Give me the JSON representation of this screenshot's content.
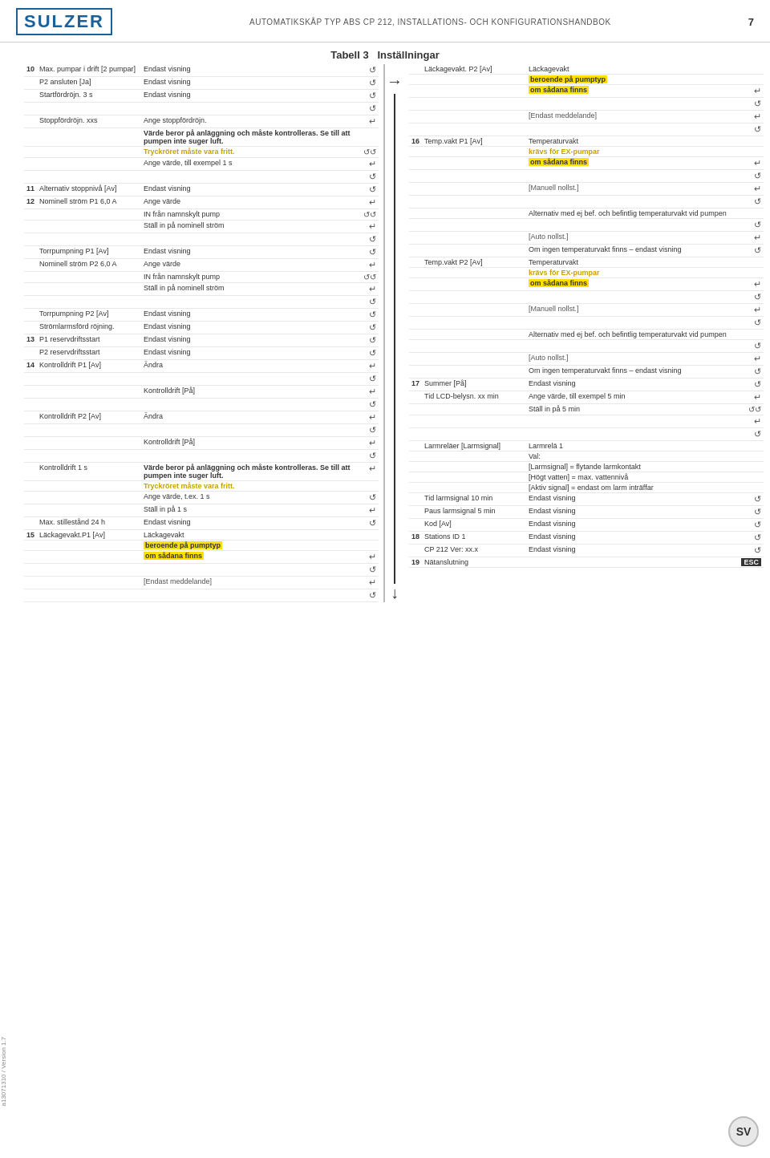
{
  "header": {
    "logo": "SULZER",
    "title": "AUTOMATIKSKÅP TYP ABS CP 212, INSTALLATIONS- OCH KONFIGURATIONSHANDBOK",
    "page_number": "7"
  },
  "table_title": "Tabell 3",
  "table_subtitle": "Inställningar",
  "sidebar_text": "a13071310 / Version 1.7",
  "sv_label": "SV",
  "left_column": {
    "rows": [
      {
        "num": "10",
        "label": "Max. pumpar i drift [2 pumpar]",
        "desc": "Endast visning",
        "icon": "↺",
        "highlight": false
      },
      {
        "num": "",
        "label": "P2 ansluten   [Ja]",
        "desc": "Endast visning",
        "icon": "↺",
        "highlight": false
      },
      {
        "num": "",
        "label": "Startfördröjn.   3 s",
        "desc": "Endast visning",
        "icon": "↺",
        "highlight": false
      },
      {
        "num": "",
        "label": "",
        "desc": "",
        "icon": "↺",
        "highlight": false
      },
      {
        "num": "",
        "label": "Stoppfördröjn.   xxs",
        "desc": "Ange stoppfördröjn.",
        "icon": "↵",
        "highlight": false
      },
      {
        "num": "",
        "label": "",
        "desc": "Värde beror på anläggning och måste kontrolleras. Se till att pumpen inte suger luft.",
        "icon": "",
        "highlight": false,
        "desc_bold": true
      },
      {
        "num": "",
        "label": "",
        "desc": "Tryckröret måste vara fritt.",
        "icon": "↺↺",
        "highlight": true,
        "yellow": true
      },
      {
        "num": "",
        "label": "",
        "desc": "Ange värde, till exempel 1 s",
        "icon": "↵",
        "highlight": false
      },
      {
        "num": "",
        "label": "",
        "desc": "",
        "icon": "↺",
        "highlight": false
      },
      {
        "num": "11",
        "label": "Alternativ stoppnivå   [Av]",
        "desc": "Endast visning",
        "icon": "↺",
        "highlight": false
      },
      {
        "num": "12",
        "label": "Nominell ström P1 6,0 A",
        "desc": "Ange värde",
        "icon": "↵",
        "highlight": false
      },
      {
        "num": "",
        "label": "",
        "desc": "IN från namnskylt pump",
        "icon": "↺↺",
        "highlight": false
      },
      {
        "num": "",
        "label": "",
        "desc": "Ställ in på nominell ström",
        "icon": "↵",
        "highlight": false
      },
      {
        "num": "",
        "label": "",
        "desc": "",
        "icon": "↺",
        "highlight": false
      },
      {
        "num": "",
        "label": "Torrpumpning P1   [Av]",
        "desc": "Endast visning",
        "icon": "↺",
        "highlight": false
      },
      {
        "num": "",
        "label": "Nominell ström P2 6,0 A",
        "desc": "Ange värde",
        "icon": "↵",
        "highlight": false
      },
      {
        "num": "",
        "label": "",
        "desc": "IN från namnskylt pump",
        "icon": "↺↺",
        "highlight": false
      },
      {
        "num": "",
        "label": "",
        "desc": "Ställ in på nominell ström",
        "icon": "↵",
        "highlight": false
      },
      {
        "num": "",
        "label": "",
        "desc": "",
        "icon": "↺",
        "highlight": false
      },
      {
        "num": "",
        "label": "Torrpumpning P2   [Av]",
        "desc": "Endast visning",
        "icon": "↺",
        "highlight": false
      },
      {
        "num": "",
        "label": "Strömlarmsförd röjning.",
        "desc": "Endast visning",
        "icon": "↺",
        "highlight": false
      },
      {
        "num": "13",
        "label": "P1 reservdriftsstart",
        "desc": "Endast visning",
        "icon": "↺",
        "highlight": false
      },
      {
        "num": "",
        "label": "P2 reservdriftsstart",
        "desc": "Endast visning",
        "icon": "↺",
        "highlight": false
      },
      {
        "num": "14",
        "label": "Kontrolldrift P1   [Av]",
        "desc": "Ändra",
        "icon": "↵",
        "highlight": false
      },
      {
        "num": "",
        "label": "",
        "desc": "",
        "icon": "↺",
        "highlight": false
      },
      {
        "num": "",
        "label": "",
        "desc": "Kontrolldrift [På]",
        "icon": "↵",
        "highlight": false
      },
      {
        "num": "",
        "label": "",
        "desc": "",
        "icon": "↺",
        "highlight": false
      },
      {
        "num": "",
        "label": "Kontrolldrift P2   [Av]",
        "desc": "Ändra",
        "icon": "↵",
        "highlight": false
      },
      {
        "num": "",
        "label": "",
        "desc": "",
        "icon": "↺",
        "highlight": false
      },
      {
        "num": "",
        "label": "",
        "desc": "Kontrolldrift [På]",
        "icon": "↵",
        "highlight": false
      },
      {
        "num": "",
        "label": "",
        "desc": "",
        "icon": "↺",
        "highlight": false
      },
      {
        "num": "",
        "label": "Kontrolldrift   1 s",
        "desc": "Värde beror på anläggning och måste kontrolleras. Se till att pumpen inte suger luft.",
        "icon": "↵",
        "highlight": false,
        "desc_bold": true
      },
      {
        "num": "",
        "label": "",
        "desc": "Tryckröret måste vara fritt.",
        "icon": "",
        "highlight": true,
        "yellow": true
      },
      {
        "num": "",
        "label": "",
        "desc": "Ange värde, t.ex. 1 s",
        "icon": "↺",
        "highlight": false
      },
      {
        "num": "",
        "label": "",
        "desc": "Ställ in på 1 s",
        "icon": "↵",
        "highlight": false
      },
      {
        "num": "",
        "label": "Max. stillestånd   24 h",
        "desc": "Endast visning",
        "icon": "↺",
        "highlight": false
      },
      {
        "num": "15",
        "label": "Läckagevakt.P1 [Av]",
        "desc": "Läckagevakt",
        "icon": "",
        "highlight": false
      },
      {
        "num": "",
        "label": "",
        "desc": "beroende på pumptyp",
        "icon": "",
        "highlight": true
      },
      {
        "num": "",
        "label": "",
        "desc": "om sådana finns",
        "icon": "↵",
        "highlight": true
      },
      {
        "num": "",
        "label": "",
        "desc": "",
        "icon": "↺",
        "highlight": false
      },
      {
        "num": "",
        "label": "",
        "desc": "[Endast meddelande]",
        "icon": "↵",
        "highlight": false,
        "bracket": true
      },
      {
        "num": "",
        "label": "",
        "desc": "",
        "icon": "↺",
        "highlight": false
      }
    ]
  },
  "right_column": {
    "rows": [
      {
        "num": "",
        "label": "Läckagevakt. P2 [Av]",
        "desc": "Läckagevakt",
        "icon": "",
        "highlight": false
      },
      {
        "num": "",
        "label": "",
        "desc": "beroende på pumptyp",
        "icon": "",
        "highlight": true
      },
      {
        "num": "",
        "label": "",
        "desc": "om sådana finns",
        "icon": "↵",
        "highlight": true
      },
      {
        "num": "",
        "label": "",
        "desc": "",
        "icon": "↺",
        "highlight": false
      },
      {
        "num": "",
        "label": "",
        "desc": "[Endast meddelande]",
        "icon": "↵",
        "highlight": false,
        "bracket": true
      },
      {
        "num": "",
        "label": "",
        "desc": "",
        "icon": "↺",
        "highlight": false
      },
      {
        "num": "16",
        "label": "Temp.vakt P1 [Av]",
        "desc": "Temperaturvakt",
        "icon": "",
        "highlight": false
      },
      {
        "num": "",
        "label": "",
        "desc": "krävs för EX-pumpar",
        "icon": "",
        "highlight": true,
        "yellow": true
      },
      {
        "num": "",
        "label": "",
        "desc": "om sådana finns",
        "icon": "↵",
        "highlight": true
      },
      {
        "num": "",
        "label": "",
        "desc": "",
        "icon": "↺",
        "highlight": false
      },
      {
        "num": "",
        "label": "",
        "desc": "[Manuell nollst.]",
        "icon": "↵",
        "highlight": false,
        "bracket": true
      },
      {
        "num": "",
        "label": "",
        "desc": "",
        "icon": "↺",
        "highlight": false
      },
      {
        "num": "",
        "label": "",
        "desc": "Alternativ med ej bef. och befintlig temperaturvakt vid pumpen",
        "icon": "",
        "highlight": false
      },
      {
        "num": "",
        "label": "",
        "desc": "",
        "icon": "↺",
        "highlight": false
      },
      {
        "num": "",
        "label": "",
        "desc": "[Auto nollst.]",
        "icon": "↵",
        "highlight": false,
        "bracket": true
      },
      {
        "num": "",
        "label": "",
        "desc": "Om ingen temperaturvakt finns – endast visning",
        "icon": "↺",
        "highlight": false
      },
      {
        "num": "",
        "label": "Temp.vakt P2 [Av]",
        "desc": "Temperaturvakt",
        "icon": "",
        "highlight": false
      },
      {
        "num": "",
        "label": "",
        "desc": "krävs för EX-pumpar",
        "icon": "",
        "highlight": true,
        "yellow": true
      },
      {
        "num": "",
        "label": "",
        "desc": "om sådana finns",
        "icon": "↵",
        "highlight": true
      },
      {
        "num": "",
        "label": "",
        "desc": "",
        "icon": "↺",
        "highlight": false
      },
      {
        "num": "",
        "label": "",
        "desc": "[Manuell nollst.]",
        "icon": "↵",
        "highlight": false,
        "bracket": true
      },
      {
        "num": "",
        "label": "",
        "desc": "",
        "icon": "↺",
        "highlight": false
      },
      {
        "num": "",
        "label": "",
        "desc": "Alternativ med ej bef. och befintlig temperaturvakt vid pumpen",
        "icon": "",
        "highlight": false
      },
      {
        "num": "",
        "label": "",
        "desc": "",
        "icon": "↺",
        "highlight": false
      },
      {
        "num": "",
        "label": "",
        "desc": "[Auto nollst.]",
        "icon": "↵",
        "highlight": false,
        "bracket": true
      },
      {
        "num": "",
        "label": "",
        "desc": "Om ingen temperaturvakt finns – endast visning",
        "icon": "↺",
        "highlight": false
      },
      {
        "num": "17",
        "label": "Summer   [På]",
        "desc": "Endast visning",
        "icon": "↺",
        "highlight": false
      },
      {
        "num": "",
        "label": "Tid LCD-belysn.   xx min",
        "desc": "Ange värde, till exempel 5 min",
        "icon": "↵",
        "highlight": false
      },
      {
        "num": "",
        "label": "",
        "desc": "Ställ in på 5 min",
        "icon": "↺↺",
        "highlight": false
      },
      {
        "num": "",
        "label": "",
        "desc": "",
        "icon": "↵",
        "highlight": false
      },
      {
        "num": "",
        "label": "",
        "desc": "",
        "icon": "↺",
        "highlight": false
      },
      {
        "num": "",
        "label": "Larmreläer   [Larmsignal]",
        "desc": "Larmrelä 1",
        "icon": "",
        "highlight": false
      },
      {
        "num": "",
        "label": "",
        "desc": "Val:",
        "icon": "",
        "highlight": false
      },
      {
        "num": "",
        "label": "",
        "desc": "[Larmsignal] = flytande larmkontakt",
        "icon": "",
        "highlight": false
      },
      {
        "num": "",
        "label": "",
        "desc": "[Högt vatten] = max. vattennivå",
        "icon": "",
        "highlight": false
      },
      {
        "num": "",
        "label": "",
        "desc": "[Aktiv signal] = endast om larm inträffar",
        "icon": "",
        "highlight": false
      },
      {
        "num": "",
        "label": "Tid larmsignal   10 min",
        "desc": "Endast visning",
        "icon": "↺",
        "highlight": false
      },
      {
        "num": "",
        "label": "Paus larmsignal   5 min",
        "desc": "Endast visning",
        "icon": "↺",
        "highlight": false
      },
      {
        "num": "",
        "label": "Kod   [Av]",
        "desc": "Endast visning",
        "icon": "↺",
        "highlight": false
      },
      {
        "num": "18",
        "label": "Stations ID   1",
        "desc": "Endast visning",
        "icon": "↺",
        "highlight": false
      },
      {
        "num": "",
        "label": "CP 212 Ver:   xx.x",
        "desc": "Endast visning",
        "icon": "↺",
        "highlight": false
      },
      {
        "num": "19",
        "label": "Nätanslutning",
        "desc": "",
        "icon": "ESC",
        "highlight": false,
        "esc": true
      }
    ]
  }
}
